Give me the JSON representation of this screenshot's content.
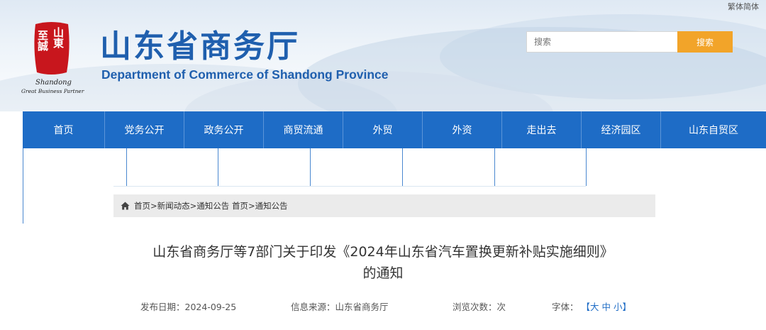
{
  "header": {
    "lang_switch": "繁体简体",
    "seal_lines": [
      "至誠",
      "山東"
    ],
    "logo_text_1": "Shandong",
    "logo_text_2": "Great Business Partner",
    "title": "山东省商务厅",
    "subtitle": "Department of Commerce of Shandong Province"
  },
  "search": {
    "placeholder": "搜索",
    "button_label": "搜索"
  },
  "nav": {
    "items": [
      "首页",
      "党务公开",
      "政务公开",
      "商贸流通",
      "外贸",
      "外资",
      "走出去",
      "经济园区",
      "山东自贸区"
    ]
  },
  "breadcrumb": {
    "items": [
      "首页",
      "新闻动态",
      "通知公告",
      "首页",
      "通知公告"
    ],
    "separators": [
      ">",
      ">",
      " ",
      ">"
    ]
  },
  "article": {
    "title_line1": "山东省商务厅等7部门关于印发《2024年山东省汽车置换更新补贴实施细则》",
    "title_line2": "的通知",
    "publish_label": "发布日期：",
    "publish_date": "2024-09-25",
    "source_label": "信息来源：",
    "source": "山东省商务厅",
    "views_label": "浏览次数：",
    "views_suffix": "次",
    "font_label": "字体：",
    "font_open": "【",
    "font_large": "大",
    "font_medium": "中",
    "font_small": "小",
    "font_close": "】"
  },
  "colors": {
    "brand_blue": "#1e6cc6",
    "title_blue": "#1f5fae",
    "search_orange": "#f2a429",
    "seal_red": "#c8161d"
  },
  "icons": {
    "home": "home-icon",
    "seal": "seal-logo"
  }
}
